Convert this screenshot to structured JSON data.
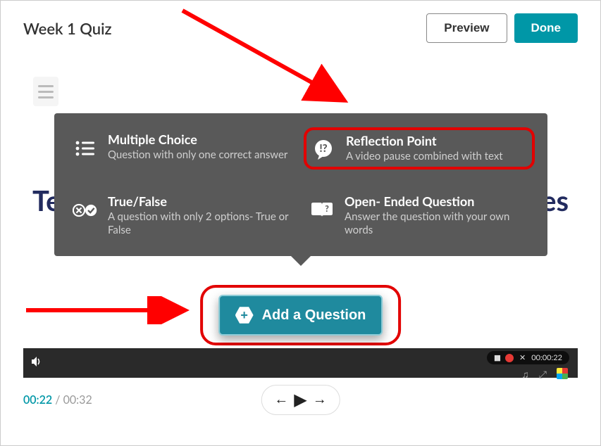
{
  "header": {
    "title": "Week 1 Quiz",
    "preview_label": "Preview",
    "done_label": "Done"
  },
  "prompt_text": "Tell us a little bit about one of your hobbies",
  "question_types": {
    "multiple_choice": {
      "title": "Multiple Choice",
      "desc": "Question with only one correct answer"
    },
    "reflection_point": {
      "title": "Reflection Point",
      "desc": "A video pause combined with text"
    },
    "true_false": {
      "title": "True/False",
      "desc": "A question with only 2 options- True or False"
    },
    "open_ended": {
      "title": "Open- Ended Question",
      "desc": "Answer the question with your own words"
    }
  },
  "add_question_label": "Add a Question",
  "video": {
    "current_time": "00:22",
    "duration": "00:32",
    "overlay_time": "00:00:22"
  }
}
